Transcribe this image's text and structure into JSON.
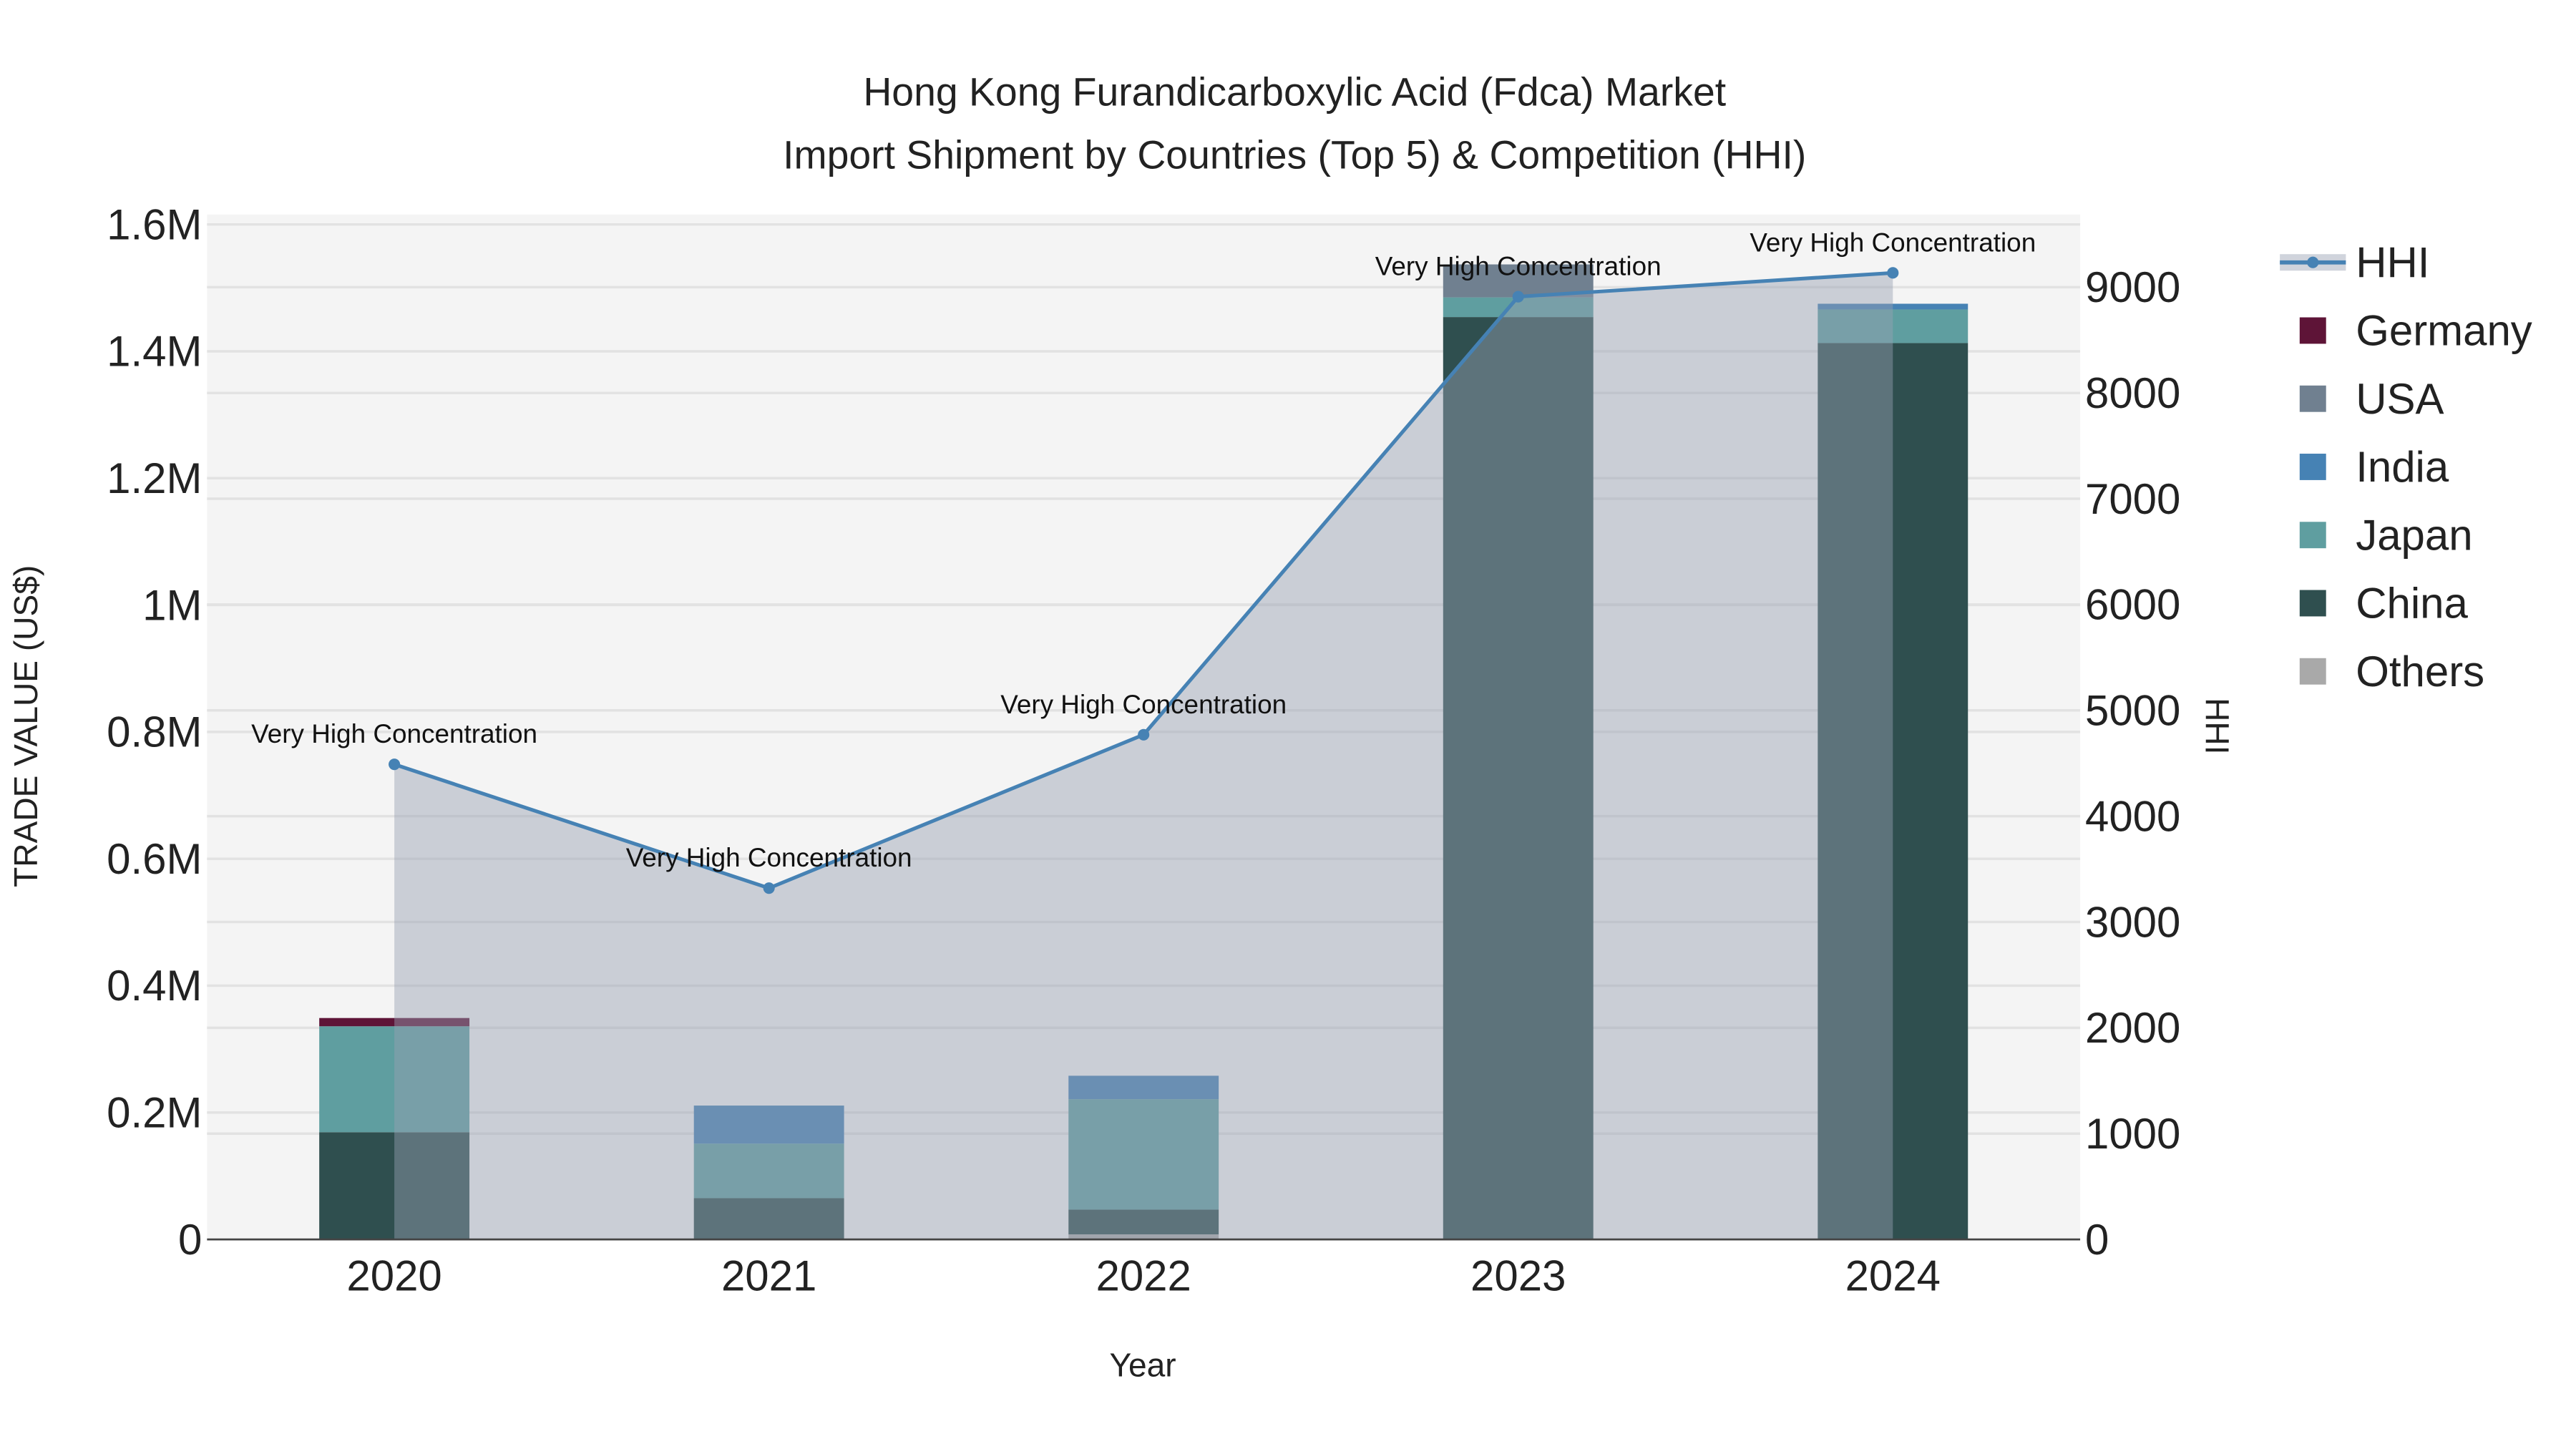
{
  "chart_data": {
    "type": "bar",
    "stacked": true,
    "title_line1": "Hong Kong Furandicarboxylic Acid (Fdca) Market",
    "title_line2": "Import Shipment by Countries (Top 5) & Competition (HHI)",
    "xlabel": "Year",
    "ylabel": "TRADE VALUE (US$)",
    "y2label": "HHI",
    "categories": [
      "2020",
      "2021",
      "2022",
      "2023",
      "2024"
    ],
    "ylim": [
      0,
      1600000
    ],
    "y_ticks": [
      0,
      200000,
      400000,
      600000,
      800000,
      1000000,
      1200000,
      1400000,
      1600000
    ],
    "y_tick_labels": [
      "0",
      "0.2M",
      "0.4M",
      "0.6M",
      "0.8M",
      "1M",
      "1.2M",
      "1.4M",
      "1.6M"
    ],
    "y2lim": [
      0,
      9600
    ],
    "y2_ticks": [
      0,
      1000,
      2000,
      3000,
      4000,
      5000,
      6000,
      7000,
      8000,
      9000
    ],
    "y2_tick_labels": [
      "0",
      "1000",
      "2000",
      "3000",
      "4000",
      "5000",
      "6000",
      "7000",
      "8000",
      "9000"
    ],
    "series": [
      {
        "name": "Others",
        "color": "#a9a9a9",
        "values": [
          0,
          0,
          8000,
          0,
          0
        ]
      },
      {
        "name": "China",
        "color": "#2f4f4f",
        "values": [
          169000,
          65000,
          39000,
          1454000,
          1413000
        ]
      },
      {
        "name": "Japan",
        "color": "#5f9ea0",
        "values": [
          167000,
          86000,
          174000,
          31000,
          53000
        ]
      },
      {
        "name": "India",
        "color": "#4682b4",
        "values": [
          0,
          60000,
          37000,
          0,
          9000
        ]
      },
      {
        "name": "USA",
        "color": "#708090",
        "values": [
          0,
          0,
          0,
          52000,
          0
        ]
      },
      {
        "name": "Germany",
        "color": "#5e1437",
        "values": [
          13000,
          0,
          0,
          0,
          0
        ]
      }
    ],
    "hhi": {
      "name": "HHI",
      "color": "#4682b4",
      "values": [
        4490,
        3320,
        4770,
        8910,
        9135
      ],
      "annotations": [
        "Very High Concentration",
        "Very High Concentration",
        "Very High Concentration",
        "Very High Concentration",
        "Very High Concentration"
      ]
    },
    "legend": [
      "HHI",
      "Germany",
      "USA",
      "India",
      "Japan",
      "China",
      "Others"
    ],
    "legend_position": "right",
    "grid": true
  }
}
